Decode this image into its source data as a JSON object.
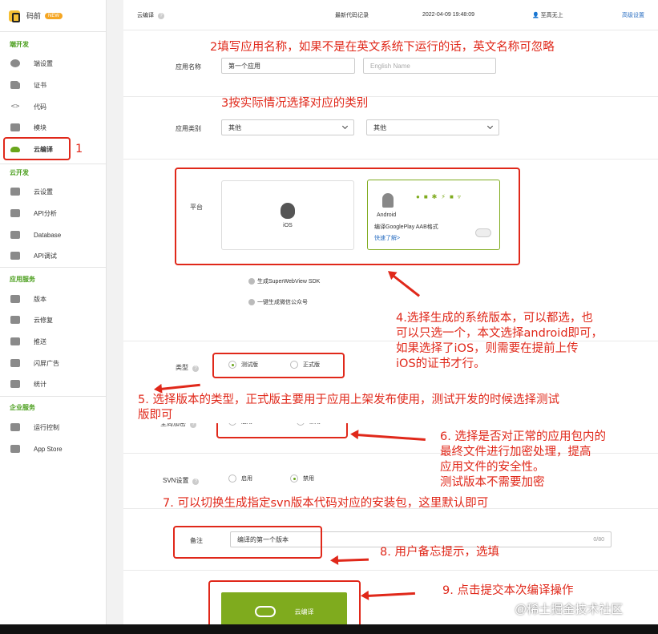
{
  "app": {
    "name": "码前",
    "badge": "NEW"
  },
  "sidebar": {
    "sections": [
      {
        "title": "端开发",
        "items": [
          "端设置",
          "证书",
          "代码",
          "模块",
          "云编译"
        ]
      },
      {
        "title": "云开发",
        "items": [
          "云设置",
          "API分析",
          "Database",
          "API调试"
        ]
      },
      {
        "title": "应用服务",
        "items": [
          "版本",
          "云修复",
          "推送",
          "闪屏广告",
          "统计"
        ]
      },
      {
        "title": "企业服务",
        "items": [
          "运行控制",
          "App Store"
        ]
      }
    ],
    "active": "云编译"
  },
  "topbar": {
    "title": "云编译",
    "latest_label": "最新代码记录",
    "date": "2022-04-09 19:48:09",
    "user": "至高无上",
    "advanced": "高级设置"
  },
  "form": {
    "app_name_label": "应用名称",
    "app_name_value": "第一个应用",
    "app_en_placeholder": "English Name",
    "app_type_label": "应用类别",
    "type1": "其他",
    "type2": "其他",
    "platform_label": "平台",
    "ios": "iOS",
    "android": "Android",
    "android_aab": "编译GooglePlay AAB格式",
    "android_more": "快速了解>",
    "super_sdk": "生成SuperWebView SDK",
    "wechat": "一键生成微信公众号",
    "build_type_label": "类型",
    "build_test": "测试版",
    "build_prod": "正式版",
    "encrypt_label": "全局加密",
    "encrypt_on": "启用",
    "encrypt_off": "禁用",
    "svn_label": "SVN设置",
    "svn_on": "启用",
    "svn_off": "禁用",
    "remark_label": "备注",
    "remark_value": "编译的第一个版本",
    "remark_count": "0/80",
    "submit": "云编译"
  },
  "annotations": {
    "a1": "1",
    "a2": "2填写应用名称，如果不是在英文系统下运行的话，英文名称可忽略",
    "a3": "3按实际情况选择对应的类别",
    "a4": [
      "4.选择生成的系统版本，可以都选，也",
      "可以只选一个，本文选择android即可，",
      "如果选择了iOS，则需要在提前上传",
      "iOS的证书才行。"
    ],
    "a5": [
      "5. 选择版本的类型，正式版主要用于应用上架发布使用，测试开发的时候选择测试",
      "版即可"
    ],
    "a6": [
      "6. 选择是否对正常的应用包内的",
      "最终文件进行加密处理，提高",
      "应用文件的安全性。",
      "测试版本不需要加密"
    ],
    "a7": "7. 可以切换生成指定svn版本代码对应的安装包，这里默认即可",
    "a8": "8. 用户备忘提示，选填",
    "a9": "9. 点击提交本次编译操作"
  },
  "watermark": "@稀土掘金技术社区",
  "colors": {
    "accent": "#7fab1e",
    "annotation": "#e0281a",
    "section": "#4a9e1c"
  }
}
